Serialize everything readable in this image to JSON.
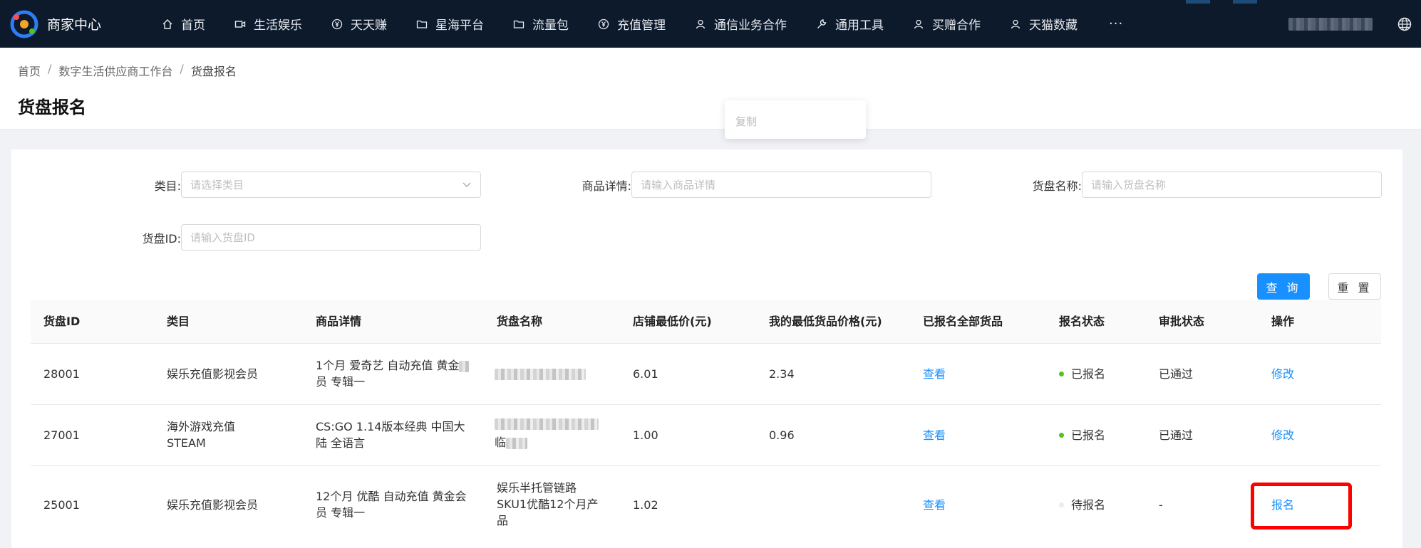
{
  "app": {
    "title": "商家中心"
  },
  "nav": {
    "items": [
      {
        "label": "首页",
        "icon": "home-icon"
      },
      {
        "label": "生活娱乐",
        "icon": "video-icon"
      },
      {
        "label": "天天赚",
        "icon": "yen-icon"
      },
      {
        "label": "星海平台",
        "icon": "folder-icon"
      },
      {
        "label": "流量包",
        "icon": "folder-icon"
      },
      {
        "label": "充值管理",
        "icon": "yen-icon"
      },
      {
        "label": "通信业务合作",
        "icon": "user-icon"
      },
      {
        "label": "通用工具",
        "icon": "wrench-icon"
      },
      {
        "label": "买赠合作",
        "icon": "user-icon"
      },
      {
        "label": "天猫数藏",
        "icon": "user-icon"
      }
    ],
    "more": "···"
  },
  "breadcrumb": {
    "items": [
      "首页",
      "数字生活供应商工作台",
      "货盘报名"
    ],
    "separator": "/"
  },
  "page": {
    "title": "货盘报名"
  },
  "popover": {
    "copy_label": "复制"
  },
  "filters": {
    "category": {
      "label": "类目:",
      "placeholder": "请选择类目"
    },
    "product_detail": {
      "label": "商品详情:",
      "placeholder": "请输入商品详情"
    },
    "pallet_name": {
      "label": "货盘名称:",
      "placeholder": "请输入货盘名称"
    },
    "pallet_id": {
      "label": "货盘ID:",
      "placeholder": "请输入货盘ID"
    }
  },
  "actions": {
    "query": "查 询",
    "reset": "重 置"
  },
  "table": {
    "columns": [
      "货盘ID",
      "类目",
      "商品详情",
      "货盘名称",
      "店铺最低价(元)",
      "我的最低货品价格(元)",
      "已报名全部货品",
      "报名状态",
      "审批状态",
      "操作"
    ],
    "rows": [
      {
        "id": "28001",
        "category": "娱乐充值影视会员",
        "detail": "1个月 爱奇艺 自动充值 黄金",
        "detail2": "员 专辑一",
        "name": "",
        "shop_min": "6.01",
        "my_min": "2.34",
        "view": "查看",
        "status": "已报名",
        "status_color": "#52c41a",
        "approval": "已通过",
        "op": "修改"
      },
      {
        "id": "27001",
        "category": "海外游戏充值",
        "category2": "STEAM",
        "detail": "CS:GO 1.14版本经典 中国大",
        "detail2": "陆 全语言",
        "name": "",
        "name2": "临",
        "shop_min": "1.00",
        "my_min": "0.96",
        "view": "查看",
        "status": "已报名",
        "status_color": "#52c41a",
        "approval": "已通过",
        "op": "修改"
      },
      {
        "id": "25001",
        "category": "娱乐充值影视会员",
        "detail": "12个月 优酷 自动充值 黄金会",
        "detail2": "员 专辑一",
        "name": "娱乐半托管链路",
        "name2": "SKU1优酷12个月产",
        "name3": "品",
        "shop_min": "1.02",
        "my_min": "",
        "view": "查看",
        "status": "待报名",
        "status_color": "#e8e8e8",
        "approval": "-",
        "op": "报名"
      }
    ]
  },
  "colors": {
    "nav_bg": "#0c1a2b",
    "primary": "#1890ff",
    "highlight": "#ff0000"
  }
}
